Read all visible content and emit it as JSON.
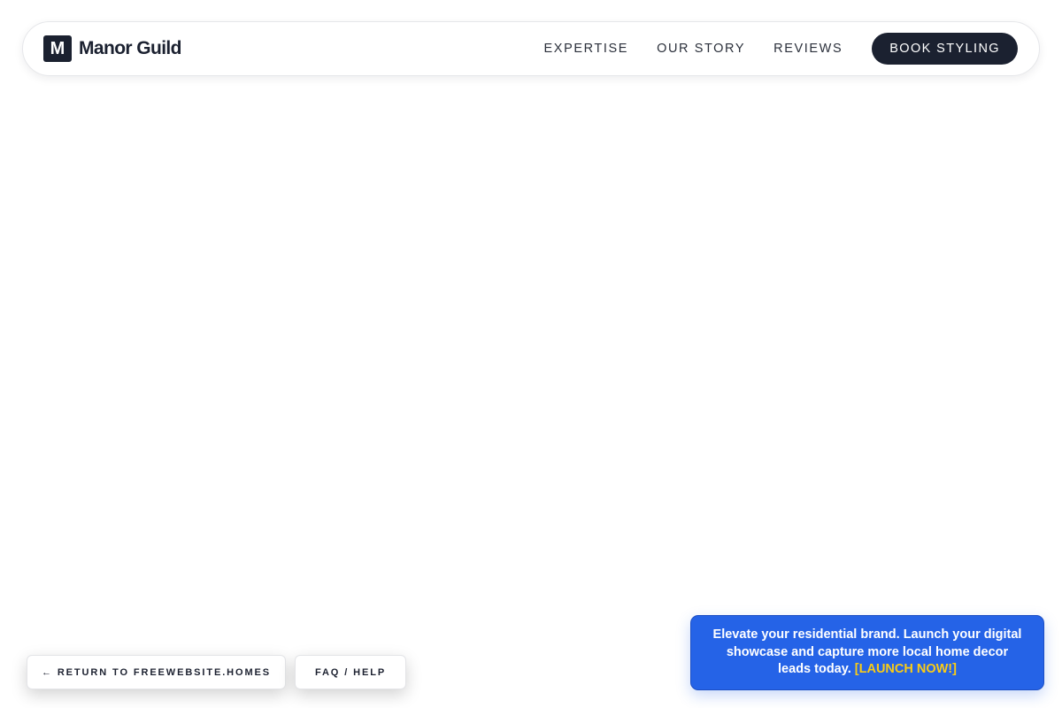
{
  "brand": {
    "mark": "M",
    "name": "Manor Guild"
  },
  "nav": {
    "links": [
      "EXPERTISE",
      "OUR STORY",
      "REVIEWS"
    ],
    "cta_label": "BOOK STYLING"
  },
  "footer_buttons": {
    "return_label": "← RETURN TO FREEWEBSITE.HOMES",
    "faq_label": "FAQ / HELP"
  },
  "promo": {
    "text": "Elevate your residential brand. Launch your digital showcase and capture more local home decor leads today.",
    "link_label": "[LAUNCH NOW!]"
  },
  "colors": {
    "dark": "#1b2130",
    "promo_blue": "#2563e7",
    "promo_link": "#facc15"
  }
}
